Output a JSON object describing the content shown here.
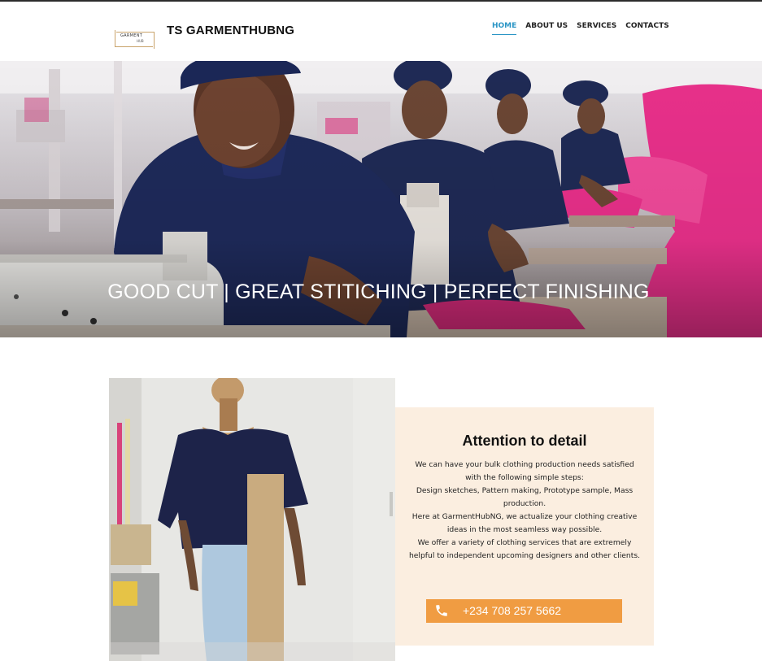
{
  "header": {
    "logo_line1": "GARMENT",
    "logo_line2": "HUB",
    "brand": "TS GARMENTHUBNG",
    "nav": [
      "HOME",
      "ABOUT US",
      "SERVICES",
      "CONTACTS"
    ],
    "active_nav": "HOME"
  },
  "hero": {
    "tagline": "GOOD CUT | GREAT STITICHING | PERFECT FINISHING"
  },
  "feature": {
    "title": "Attention to detail",
    "paragraphs": [
      "We can have your bulk clothing production needs satisfied with the following simple steps:",
      "Design sketches, Pattern making, Prototype sample, Mass production.",
      "Here at GarmentHubNG, we actualize your clothing creative ideas in the most seamless way possible.",
      "We offer a variety of clothing services that are extremely helpful to independent upcoming designers and other clients."
    ],
    "phone": "+234 708 257 5662",
    "phone_icon": "phone-icon"
  },
  "colors": {
    "accent": "#2a95c5",
    "button": "#f09c42",
    "panel_bg": "#fbeee0"
  }
}
